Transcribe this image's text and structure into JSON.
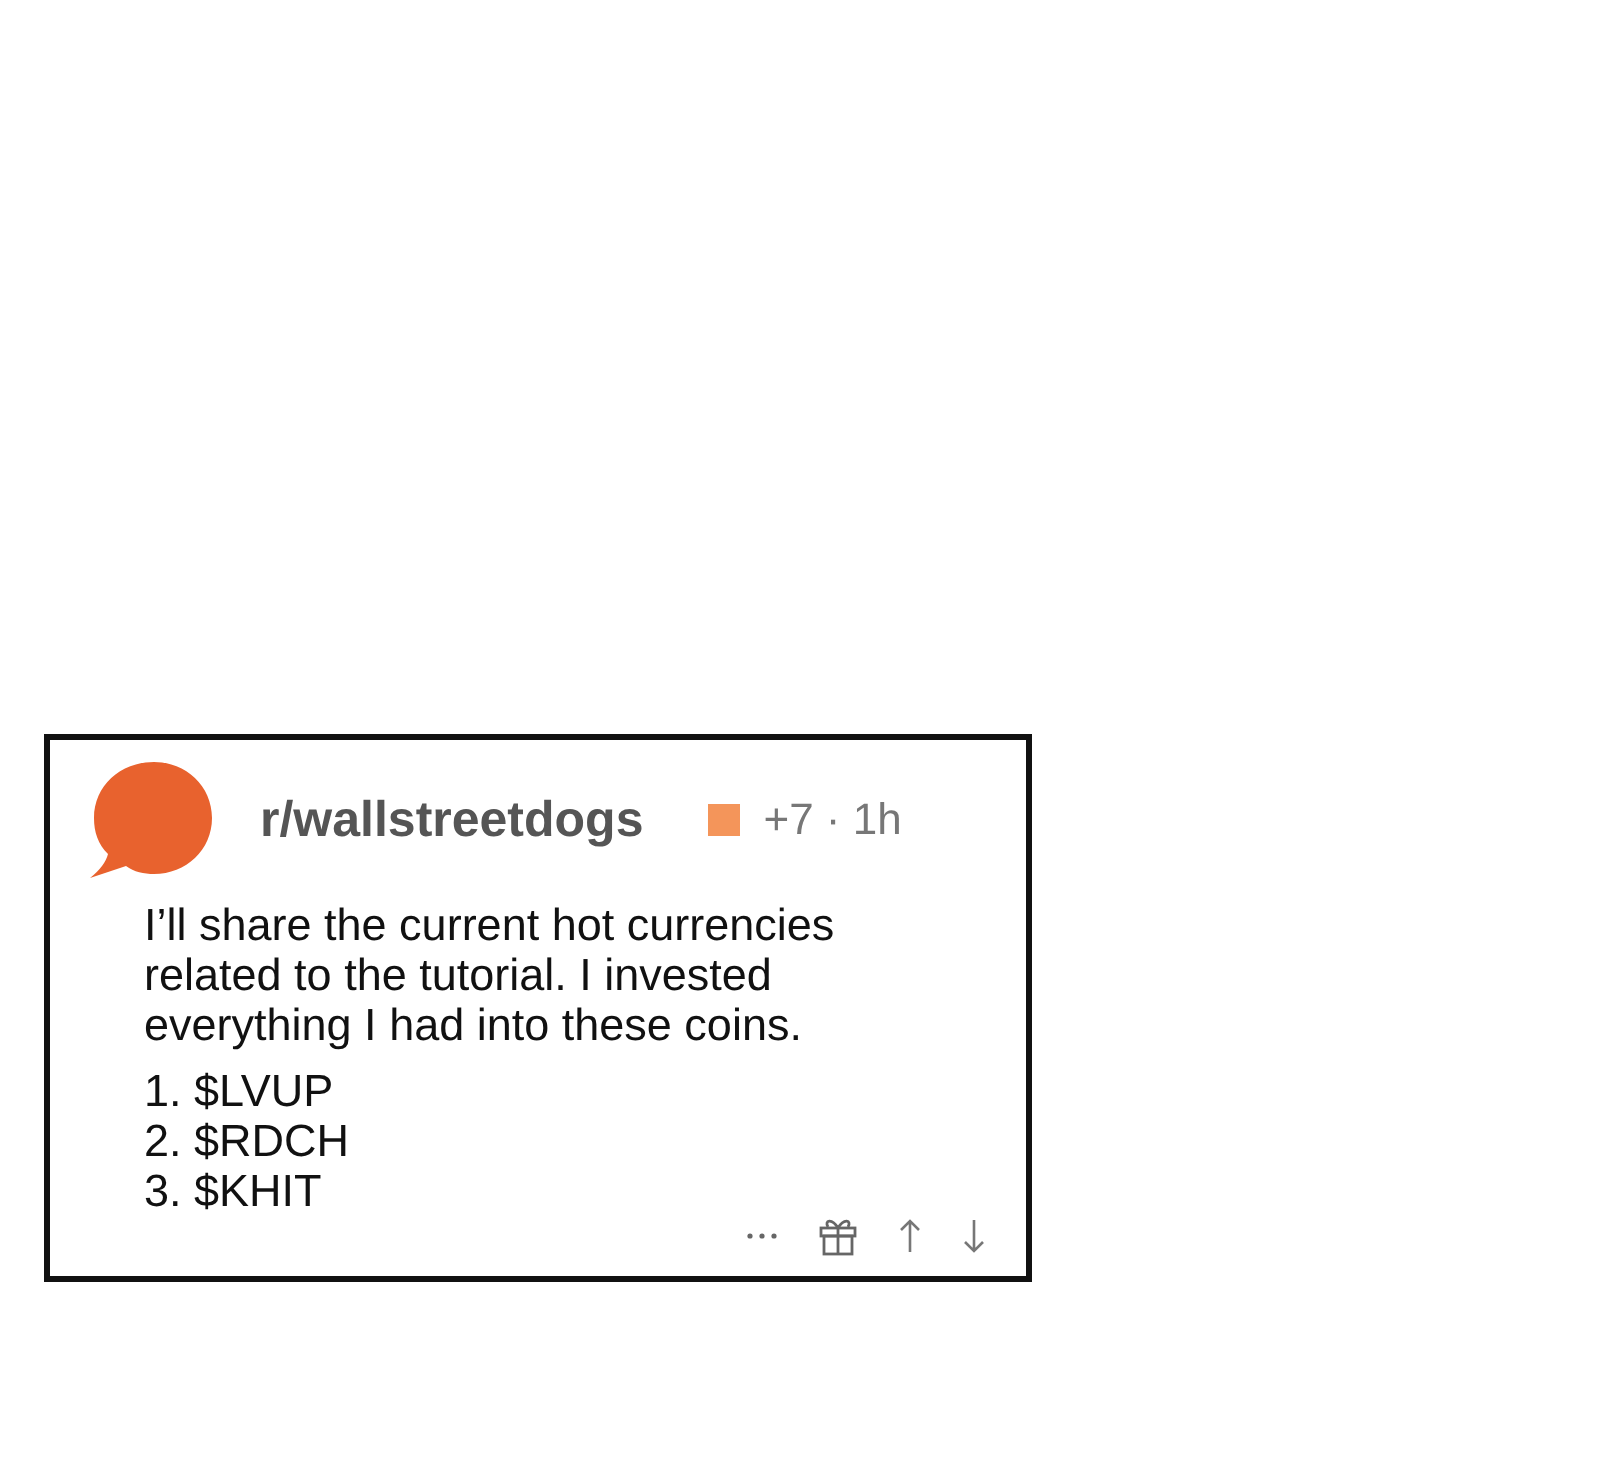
{
  "post": {
    "subreddit": "r/wallstreetdogs",
    "meta": "+7 · 1h",
    "body": "I’ll share the current hot currencies related to the tutorial. I invested everything I had into these coins.",
    "list": [
      "1. $LVUP",
      "2. $RDCH",
      "3. $KHIT"
    ],
    "actions": [
      {
        "kind": "more"
      },
      {
        "kind": "gift"
      },
      {
        "kind": "upvote"
      },
      {
        "kind": "downvote"
      }
    ]
  }
}
